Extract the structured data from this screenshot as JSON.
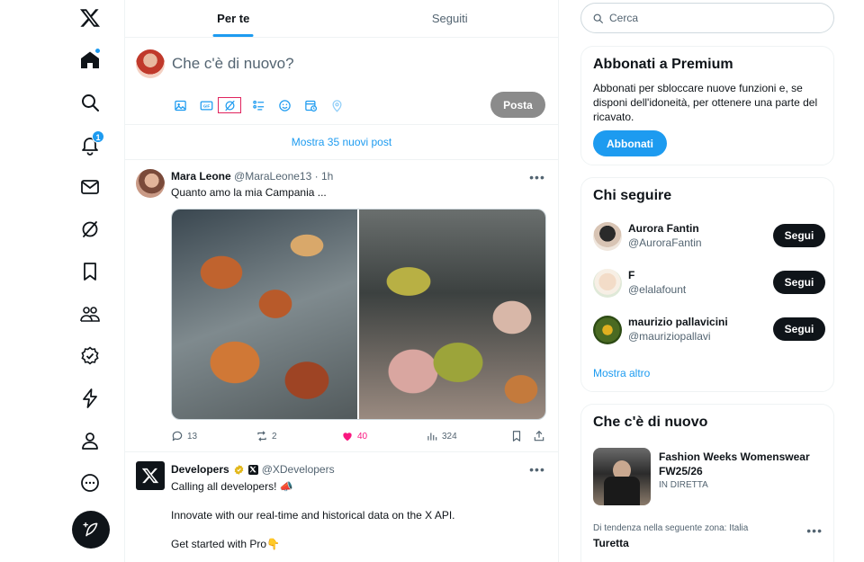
{
  "nav": {
    "items": [
      {
        "name": "x-logo-icon"
      },
      {
        "name": "home-icon"
      },
      {
        "name": "search-icon"
      },
      {
        "name": "notifications-icon",
        "badge": "1"
      },
      {
        "name": "messages-icon"
      },
      {
        "name": "grok-icon"
      },
      {
        "name": "bookmarks-icon"
      },
      {
        "name": "communities-icon"
      },
      {
        "name": "premium-icon"
      },
      {
        "name": "verified-orgs-icon"
      },
      {
        "name": "profile-icon"
      },
      {
        "name": "more-icon"
      }
    ]
  },
  "tabs": {
    "for_you": "Per te",
    "following": "Seguiti"
  },
  "composer": {
    "placeholder": "Che c'è di nuovo?",
    "post_label": "Posta"
  },
  "show_new_posts": "Mostra 35 nuovi post",
  "tweets": [
    {
      "name": "Mara Leone",
      "handle": "@MaraLeone13",
      "time": "· 1h",
      "text": "Quanto amo la mia Campania ...",
      "replies": "13",
      "reposts": "2",
      "likes": "40",
      "views": "324"
    },
    {
      "name": "Developers",
      "handle": "@XDevelopers",
      "lines": [
        "Calling all developers! 📣",
        "Innovate with our real-time and historical data on the X API.",
        "Get started with Pro👇"
      ]
    }
  ],
  "search": {
    "placeholder": "Cerca"
  },
  "premium": {
    "title": "Abbonati a Premium",
    "description": "Abbonati per sbloccare nuove funzioni e, se disponi dell'idoneità, per ottenere una parte del ricavato.",
    "button": "Abbonati"
  },
  "who_to_follow": {
    "title": "Chi seguire",
    "follow_label": "Segui",
    "users": [
      {
        "name": "Aurora Fantin",
        "handle": "@AuroraFantin"
      },
      {
        "name": "F",
        "handle": "@elalafount"
      },
      {
        "name": "maurizio pallavicini",
        "handle": "@mauriziopallavi"
      }
    ],
    "show_more": "Mostra altro"
  },
  "whats_happening": {
    "title": "Che c'è di nuovo",
    "news_title": "Fashion Weeks Womenswear FW25/26",
    "news_sub": "IN DIRETTA",
    "trend_context": "Di tendenza nella seguente zona: Italia",
    "trend_name": "Turetta"
  },
  "colors": {
    "accent": "#1d9bf0",
    "like": "#f91880",
    "text": "#0f1419",
    "muted": "#536471"
  }
}
